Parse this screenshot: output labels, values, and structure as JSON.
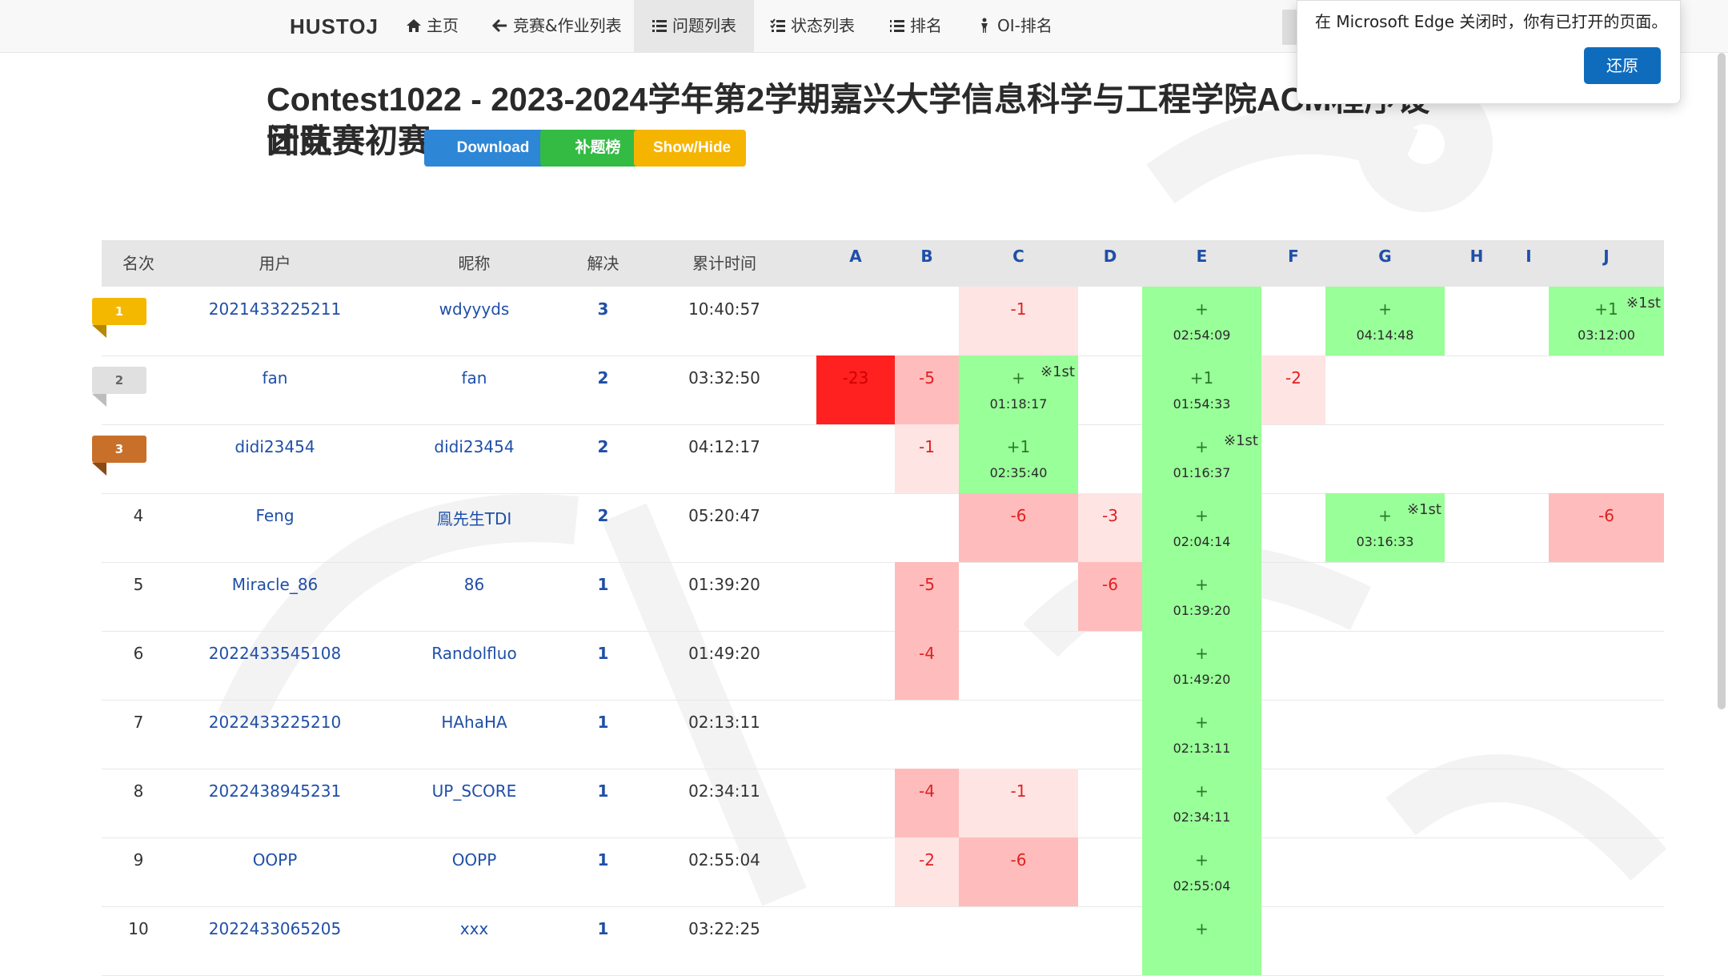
{
  "navbar": {
    "brand": "HUSTOJ",
    "items": [
      {
        "label": "主页",
        "icon": "home-icon"
      },
      {
        "label": "竞赛&作业列表",
        "icon": "arrow-left-icon"
      },
      {
        "label": "问题列表",
        "icon": "list-icon"
      },
      {
        "label": "状态列表",
        "icon": "tasks-icon"
      },
      {
        "label": "排名",
        "icon": "ordered-list-icon"
      },
      {
        "label": "OI-排名",
        "icon": "person-icon"
      }
    ]
  },
  "popup": {
    "message": "在 Microsoft Edge 关闭时，你有已打开的页面。",
    "restore_label": "还原"
  },
  "page": {
    "title_line1": "Contest1022 - 2023-2024学年第2学期嘉兴大学信息科学与工程学院ACM程序设计竞赛",
    "title_line2": "团队赛初赛",
    "download_label": "Download",
    "supplement_label": "补题榜",
    "showhide_label": "Show/Hide"
  },
  "table": {
    "headers": {
      "rank": "名次",
      "user": "用户",
      "nick": "昵称",
      "solved": "解决",
      "penalty": "累计时间"
    },
    "problems": [
      "A",
      "B",
      "C",
      "D",
      "E",
      "F",
      "G",
      "H",
      "I",
      "J"
    ],
    "rows": [
      {
        "rank": "1",
        "user": "2021433225211",
        "nick": "wdyyyds",
        "solved": "3",
        "penalty": "10:40:57",
        "cells": {
          "C": {
            "s": "wl",
            "m": "-1"
          },
          "E": {
            "s": "ac",
            "m": "+",
            "t": "02:54:09"
          },
          "G": {
            "s": "ac",
            "m": "+",
            "t": "04:14:48"
          },
          "J": {
            "s": "ac",
            "m": "+1",
            "t": "03:12:00",
            "f": "※1st"
          }
        }
      },
      {
        "rank": "2",
        "user": "fan",
        "nick": "fan",
        "solved": "2",
        "penalty": "03:32:50",
        "cells": {
          "A": {
            "s": "wd",
            "m": "-23"
          },
          "B": {
            "s": "wm",
            "m": "-5"
          },
          "C": {
            "s": "ac",
            "m": "+",
            "t": "01:18:17",
            "f": "※1st"
          },
          "E": {
            "s": "ac",
            "m": "+1",
            "t": "01:54:33"
          },
          "F": {
            "s": "wl",
            "m": "-2"
          }
        }
      },
      {
        "rank": "3",
        "user": "didi23454",
        "nick": "didi23454",
        "solved": "2",
        "penalty": "04:12:17",
        "cells": {
          "B": {
            "s": "wl",
            "m": "-1"
          },
          "C": {
            "s": "ac",
            "m": "+1",
            "t": "02:35:40"
          },
          "E": {
            "s": "ac",
            "m": "+",
            "t": "01:16:37",
            "f": "※1st"
          }
        }
      },
      {
        "rank": "4",
        "user": "Feng",
        "nick": "鳯先生TDI",
        "solved": "2",
        "penalty": "05:20:47",
        "cells": {
          "C": {
            "s": "wm",
            "m": "-6"
          },
          "D": {
            "s": "wl",
            "m": "-3"
          },
          "E": {
            "s": "ac",
            "m": "+",
            "t": "02:04:14"
          },
          "G": {
            "s": "ac",
            "m": "+",
            "t": "03:16:33",
            "f": "※1st"
          },
          "J": {
            "s": "wm",
            "m": "-6"
          }
        }
      },
      {
        "rank": "5",
        "user": "Miracle_86",
        "nick": "86",
        "solved": "1",
        "penalty": "01:39:20",
        "cells": {
          "B": {
            "s": "wm",
            "m": "-5"
          },
          "D": {
            "s": "wm",
            "m": "-6"
          },
          "E": {
            "s": "ac",
            "m": "+",
            "t": "01:39:20"
          }
        }
      },
      {
        "rank": "6",
        "user": "2022433545108",
        "nick": "Randolfluo",
        "solved": "1",
        "penalty": "01:49:20",
        "cells": {
          "B": {
            "s": "wm",
            "m": "-4"
          },
          "E": {
            "s": "ac",
            "m": "+",
            "t": "01:49:20"
          }
        }
      },
      {
        "rank": "7",
        "user": "2022433225210",
        "nick": "HAhaHA",
        "solved": "1",
        "penalty": "02:13:11",
        "cells": {
          "E": {
            "s": "ac",
            "m": "+",
            "t": "02:13:11"
          }
        }
      },
      {
        "rank": "8",
        "user": "2022438945231",
        "nick": "UP_SCORE",
        "solved": "1",
        "penalty": "02:34:11",
        "cells": {
          "B": {
            "s": "wm",
            "m": "-4"
          },
          "C": {
            "s": "wl",
            "m": "-1"
          },
          "E": {
            "s": "ac",
            "m": "+",
            "t": "02:34:11"
          }
        }
      },
      {
        "rank": "9",
        "user": "OOPP",
        "nick": "OOPP",
        "solved": "1",
        "penalty": "02:55:04",
        "cells": {
          "B": {
            "s": "wl",
            "m": "-2"
          },
          "C": {
            "s": "wm",
            "m": "-6"
          },
          "E": {
            "s": "ac",
            "m": "+",
            "t": "02:55:04"
          }
        }
      },
      {
        "rank": "10",
        "user": "2022433065205",
        "nick": "xxx",
        "solved": "1",
        "penalty": "03:22:25",
        "cells": {
          "E": {
            "s": "ac",
            "m": "+",
            "t": ""
          }
        }
      }
    ]
  },
  "colors": {
    "ac": "#99ff99",
    "wa_light": "#ffe4e4",
    "wa_mid": "#ffbcbc",
    "wa_dark": "#ff2020",
    "gold": "#f5b800",
    "silver": "#e0e0e0",
    "bronze": "#c8702a"
  }
}
